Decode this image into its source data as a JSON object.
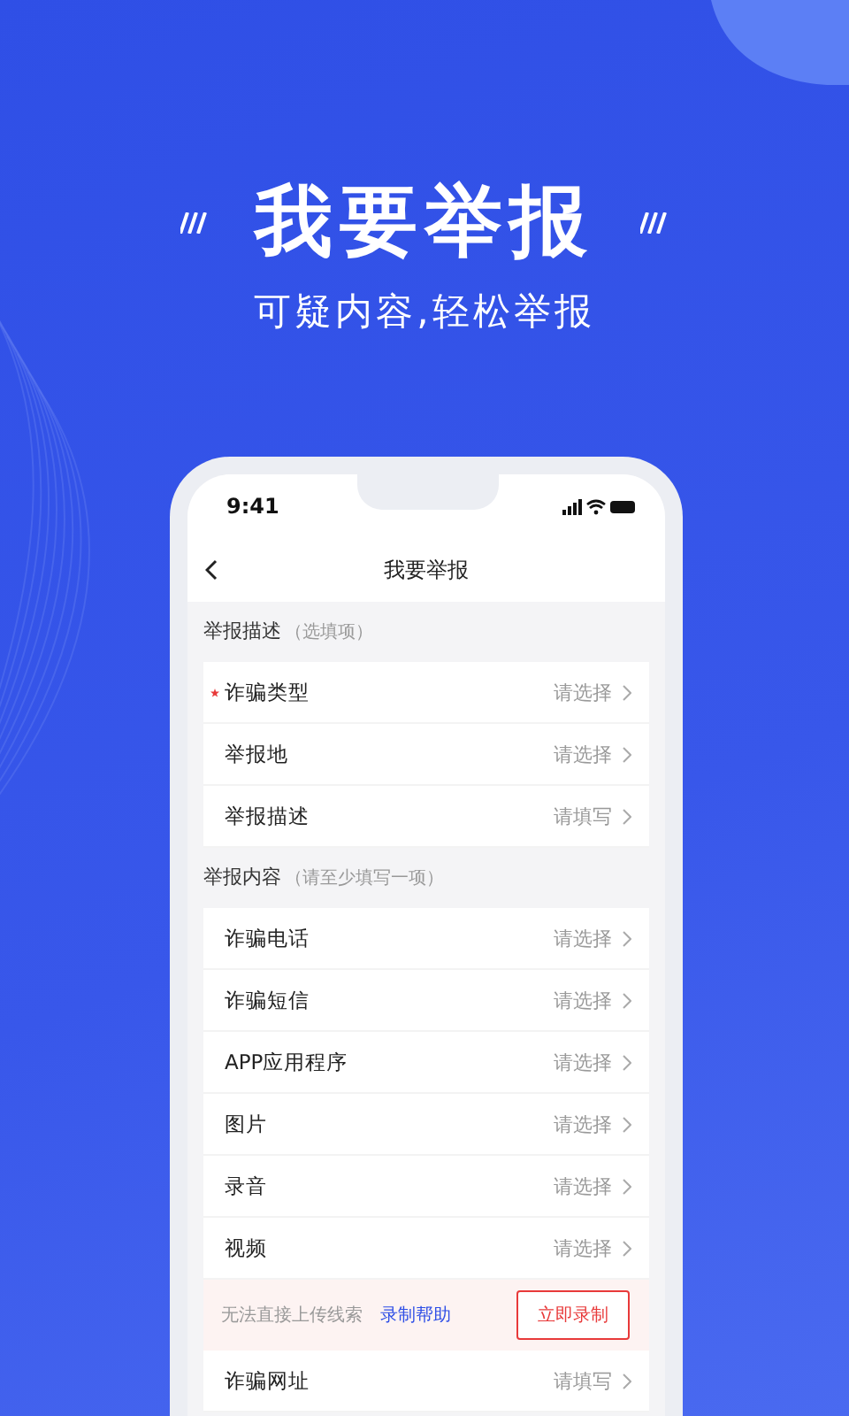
{
  "header": {
    "title": "我要举报",
    "subtitle": "可疑内容,轻松举报"
  },
  "phone": {
    "status_bar": {
      "time": "9:41"
    },
    "nav": {
      "title": "我要举报"
    },
    "sections": [
      {
        "title": "举报描述",
        "hint": "（选填项）",
        "rows": [
          {
            "kind": "field",
            "label": "诈骗类型",
            "value": "请选择",
            "required": true
          },
          {
            "kind": "field",
            "label": "举报地",
            "value": "请选择",
            "required": false
          },
          {
            "kind": "field",
            "label": "举报描述",
            "value": "请填写",
            "required": false
          }
        ]
      },
      {
        "title": "举报内容",
        "hint": "（请至少填写一项）",
        "rows": [
          {
            "kind": "field",
            "label": "诈骗电话",
            "value": "请选择",
            "required": false
          },
          {
            "kind": "field",
            "label": "诈骗短信",
            "value": "请选择",
            "required": false
          },
          {
            "kind": "field",
            "label": "APP应用程序",
            "value": "请选择",
            "required": false
          },
          {
            "kind": "field",
            "label": "图片",
            "value": "请选择",
            "required": false
          },
          {
            "kind": "field",
            "label": "录音",
            "value": "请选择",
            "required": false
          },
          {
            "kind": "field",
            "label": "视频",
            "value": "请选择",
            "required": false
          },
          {
            "kind": "notice",
            "text": "无法直接上传线索",
            "link": "录制帮助",
            "button": "立即录制"
          },
          {
            "kind": "field",
            "label": "诈骗网址",
            "value": "请填写",
            "required": false
          }
        ]
      }
    ]
  }
}
